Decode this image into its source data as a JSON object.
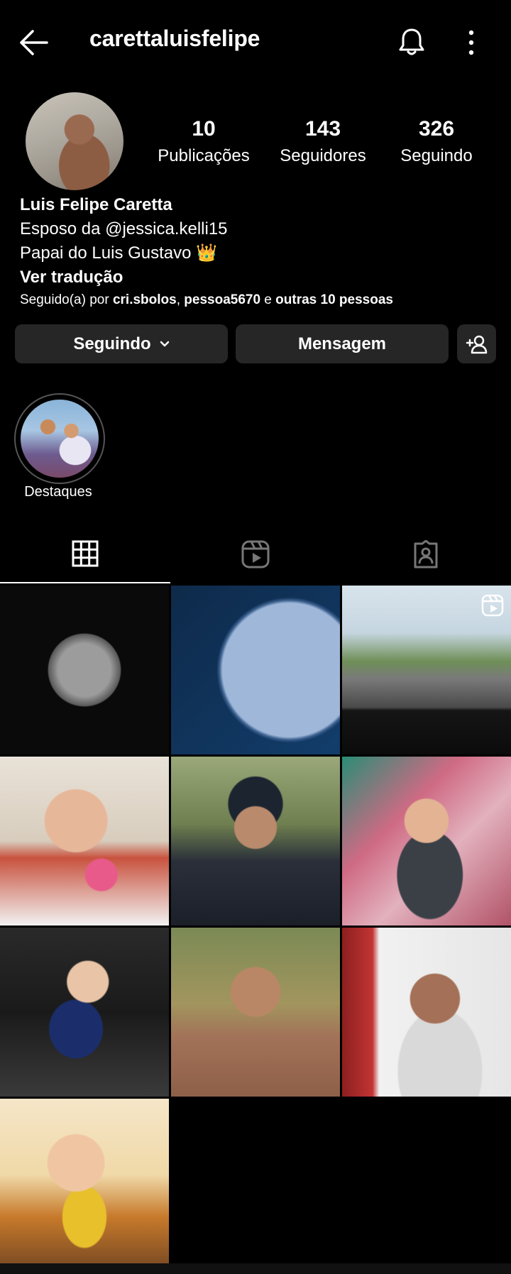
{
  "header": {
    "username": "carettaluisfelipe",
    "icons": [
      "back-arrow-icon",
      "bell-icon",
      "more-vertical-icon"
    ]
  },
  "stats": [
    {
      "value": "10",
      "label": "Publicações"
    },
    {
      "value": "143",
      "label": "Seguidores"
    },
    {
      "value": "326",
      "label": "Seguindo"
    }
  ],
  "bio": {
    "name": "Luis Felipe Caretta",
    "line1_prefix": "Esposo da ",
    "line1_mention": "@jessica.kelli15",
    "line2": "Papai do Luis Gustavo",
    "line2_emoji": "👑",
    "translate": "Ver tradução",
    "followed_prefix": "Seguido(a) por ",
    "followed_user1": "cri.sbolos",
    "followed_sep": ", ",
    "followed_user2": "pessoa5670",
    "followed_and": " e ",
    "followed_others": "outras 10 pessoas"
  },
  "actions": {
    "following_label": "Seguindo",
    "message_label": "Mensagem",
    "suggest_icon": "add-person-icon"
  },
  "highlights": [
    {
      "label": "Destaques"
    }
  ],
  "tabs": [
    "grid-icon",
    "reels-icon",
    "tagged-icon"
  ],
  "posts": [
    {
      "desc": "moon"
    },
    {
      "desc": "moon-blue"
    },
    {
      "desc": "road",
      "reel": true
    },
    {
      "desc": "child-lollipop"
    },
    {
      "desc": "man-beanie"
    },
    {
      "desc": "baby-hammock"
    },
    {
      "desc": "baby-car"
    },
    {
      "desc": "man-glasses-shirtless"
    },
    {
      "desc": "man-glasses-shop"
    },
    {
      "desc": "baby-birthday"
    }
  ],
  "colors": {
    "background": "#000000",
    "button": "#262626",
    "text": "#ffffff"
  }
}
